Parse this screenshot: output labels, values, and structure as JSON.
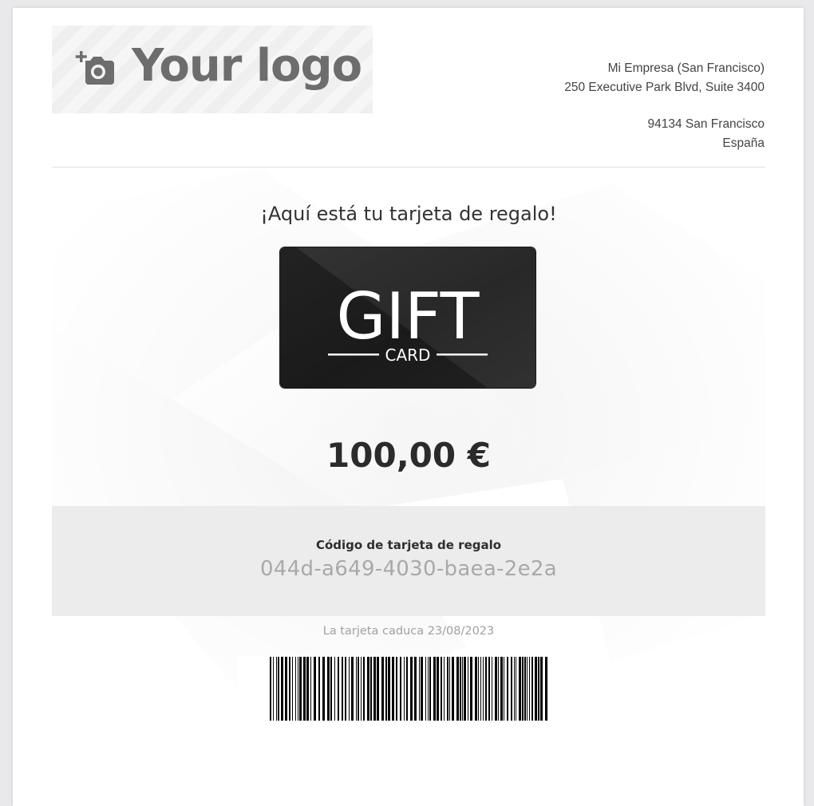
{
  "header": {
    "logo_text": "Your logo",
    "company": {
      "name": "Mi Empresa (San Francisco)",
      "street": "250 Executive Park Blvd, Suite 3400",
      "city": "94134 San Francisco",
      "country": "España"
    }
  },
  "card": {
    "headline": "¡Aquí está tu tarjeta de regalo!",
    "image_text_main": "GIFT",
    "image_text_sub": "CARD",
    "amount": "100,00 €",
    "code_label": "Código de tarjeta de regalo",
    "code_value": "044d-a649-4030-baea-2e2a",
    "expiry": "La tarjeta caduca 23/08/2023"
  },
  "colors": {
    "card_dark": "#1f1f1f",
    "code_box_bg": "#ececec",
    "code_text": "#a9a9a9"
  },
  "icons": {
    "logo_icon": "add-photo-icon"
  }
}
